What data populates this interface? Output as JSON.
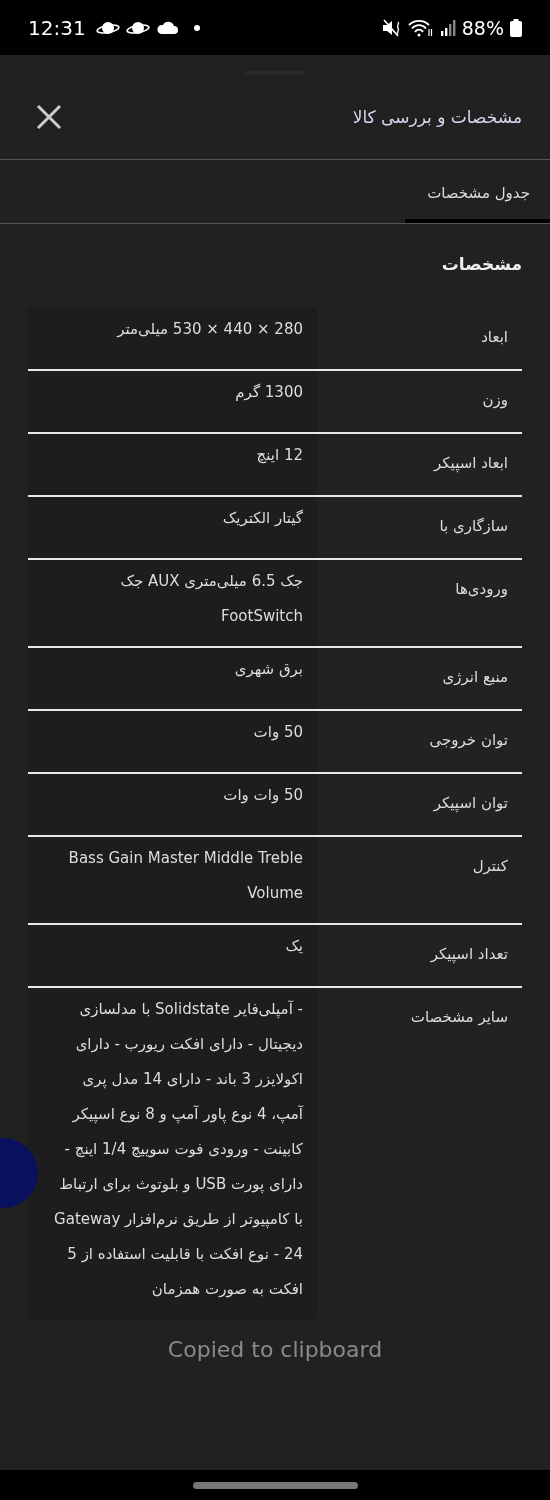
{
  "status_bar": {
    "time": "12:31",
    "battery": "88%"
  },
  "sheet": {
    "title": "مشخصات و بررسی کالا",
    "tabs": [
      {
        "label": "جدول مشخصات",
        "selected": true
      }
    ],
    "section_title": "مشخصات",
    "specs": [
      {
        "label": "ابعاد",
        "value": "280 × 440 × 530 میلی‌متر"
      },
      {
        "label": "وزن",
        "value": "1300 گرم"
      },
      {
        "label": "ابعاد اسپیکر",
        "value": "12 اینچ"
      },
      {
        "label": "سازگاری با",
        "value": "گیتار الکتریک"
      },
      {
        "label": "ورودی‌ها",
        "value": "جک 6.5 میلی‌متری AUX جک FootSwitch"
      },
      {
        "label": "منبع انرژی",
        "value": "برق شهری"
      },
      {
        "label": "توان خروجی",
        "value": "50 وات"
      },
      {
        "label": "توان اسپیکر",
        "value": "50 وات وات"
      },
      {
        "label": "کنترل",
        "value": "Bass Gain Master Middle Treble Volume"
      },
      {
        "label": "تعداد اسپیکر",
        "value": "یک"
      },
      {
        "label": "سایر مشخصات",
        "value": "- آمپلی‌فایر Solidstate با مدلسازی دیجیتال - دارای افکت ریورب - دارای اکولایزر 3 باند - دارای 14 مدل پری آمپ، 4 نوع پاور آمپ و 8 نوع اسپیکر کابینت - ورودی فوت سوییچ 1/4 اینچ - دارای پورت USB و بلوتوث برای ارتباط با کامپیوتر از طریق نرم‌افزار Gateway - 24 نوع افکت با قابلیت استفاده از 5 افکت به صورت همزمان"
      }
    ],
    "toast": "Copied to clipboard"
  }
}
